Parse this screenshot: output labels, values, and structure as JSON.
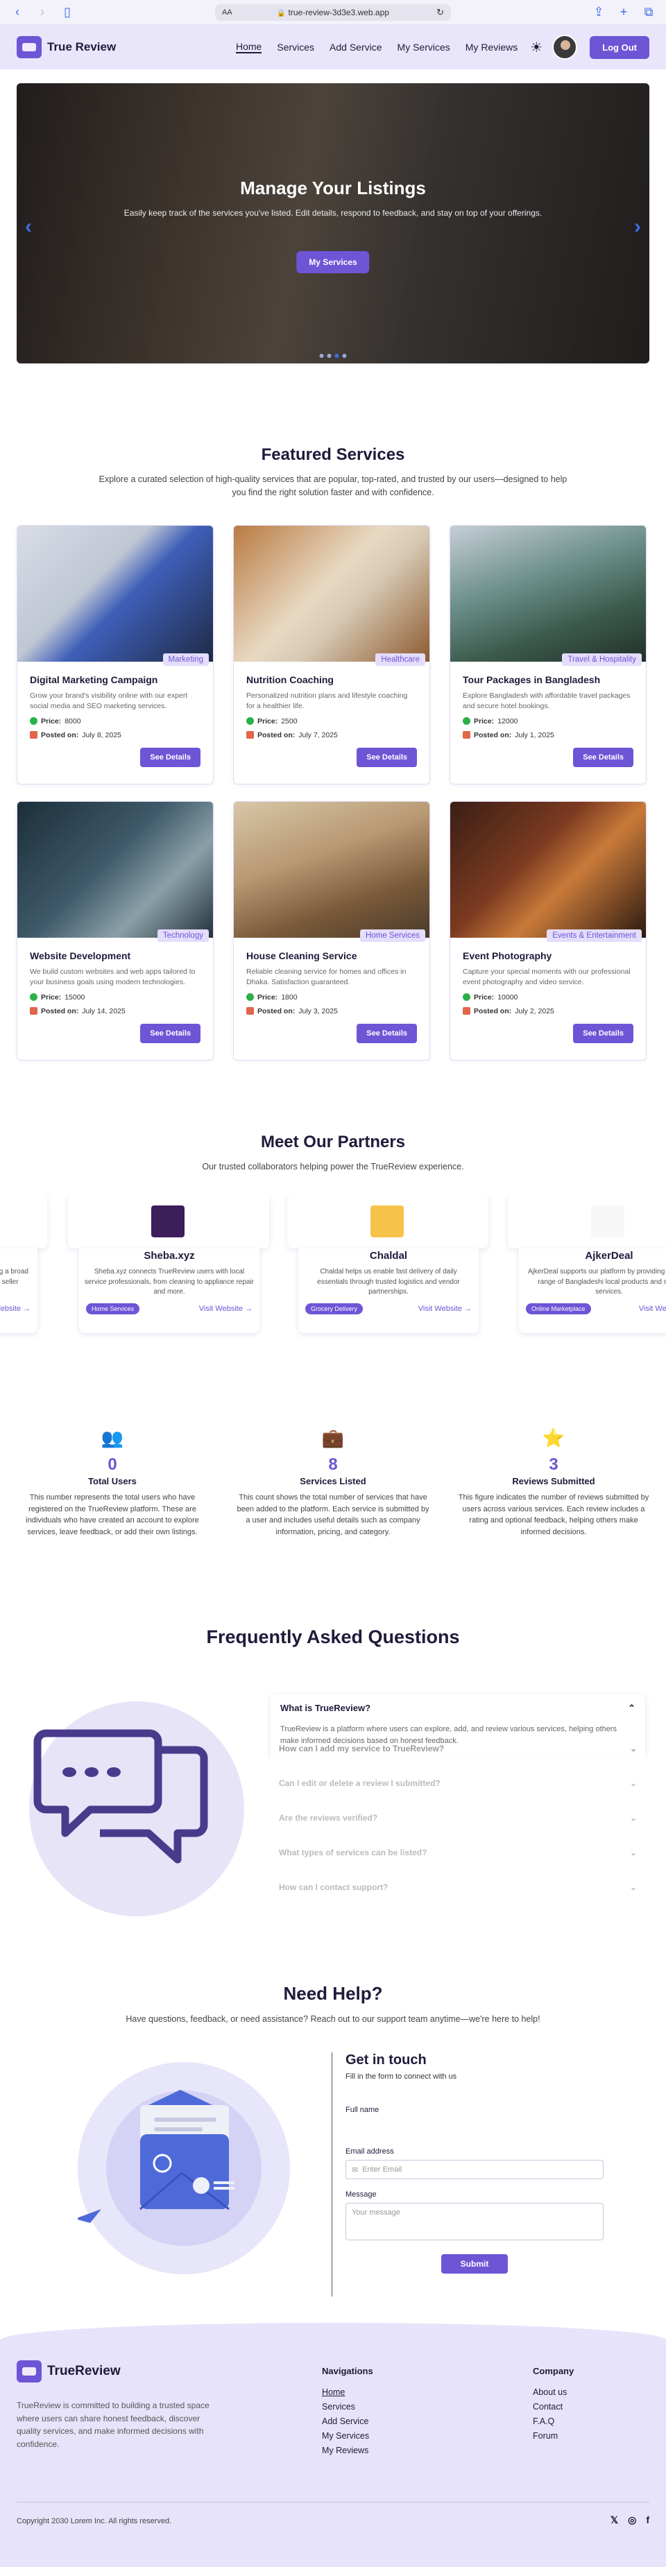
{
  "browser": {
    "aa": "AA",
    "url": "true-review-3d3e3.web.app"
  },
  "nav": {
    "brand": "True Review",
    "links": [
      "Home",
      "Services",
      "Add Service",
      "My Services",
      "My Reviews"
    ],
    "logout": "Log Out"
  },
  "hero": {
    "title": "Manage Your Listings",
    "subtitle": "Easily keep track of the services you've listed. Edit details, respond to feedback, and stay on top of your offerings.",
    "button": "My Services"
  },
  "featured": {
    "title": "Featured Services",
    "subtitle": "Explore a curated selection of high-quality services that are popular, top-rated, and trusted by our users—designed to help you find the right solution faster and with confidence.",
    "price_label": "Price:",
    "posted_label": "Posted on:",
    "button": "See Details",
    "cards": [
      {
        "tag": "Marketing",
        "title": "Digital Marketing Campaign",
        "desc": "Grow your brand's visibility online with our expert social media and SEO marketing services.",
        "price": "8000",
        "date": "July 8, 2025"
      },
      {
        "tag": "Healthcare",
        "title": "Nutrition Coaching",
        "desc": "Personalized nutrition plans and lifestyle coaching for a healthier life.",
        "price": "2500",
        "date": "July 7, 2025"
      },
      {
        "tag": "Travel & Hospitality",
        "title": "Tour Packages in Bangladesh",
        "desc": "Explore Bangladesh with affordable travel packages and secure hotel bookings.",
        "price": "12000",
        "date": "July 1, 2025"
      },
      {
        "tag": "Technology",
        "title": "Website Development",
        "desc": "We build custom websites and web apps tailored to your business goals using modern technologies.",
        "price": "15000",
        "date": "July 14, 2025"
      },
      {
        "tag": "Home Services",
        "title": "House Cleaning Service",
        "desc": "Reliable cleaning service for homes and offices in Dhaka. Satisfaction guaranteed.",
        "price": "1800",
        "date": "July 3, 2025"
      },
      {
        "tag": "Events & Entertainment",
        "title": "Event Photography",
        "desc": "Capture your special moments with our professional event photography and video service.",
        "price": "10000",
        "date": "July 2, 2025"
      }
    ]
  },
  "partners": {
    "title": "Meet Our Partners",
    "subtitle": "Our trusted collaborators helping power the TrueReview experience.",
    "link": "Visit Website →",
    "items": [
      {
        "name": "Sheba.xyz",
        "desc": "Sheba.xyz connects TrueReview users with local service professionals, from cleaning to appliance repair and more.",
        "category": "Home Services"
      },
      {
        "name": "Chaldal",
        "desc": "Chaldal helps us enable fast delivery of daily essentials through trusted logistics and vendor partnerships.",
        "category": "Grocery Delivery"
      },
      {
        "name": "AjkerDeal",
        "desc": "AjkerDeal supports our platform by providing a broad range of Bangladeshi local products and seller services.",
        "category": "Online Marketplace"
      }
    ]
  },
  "stats": [
    {
      "icon": "users-icon",
      "value": "0",
      "label": "Total Users",
      "desc": "This number represents the total users who have registered on the TrueReview platform. These are individuals who have created an account to explore services, leave feedback, or add their own listings."
    },
    {
      "icon": "briefcase-icon",
      "value": "8",
      "label": "Services Listed",
      "desc": "This count shows the total number of services that have been added to the platform. Each service is submitted by a user and includes useful details such as company information, pricing, and category."
    },
    {
      "icon": "star-icon",
      "value": "3",
      "label": "Reviews Submitted",
      "desc": "This figure indicates the number of reviews submitted by users across various services. Each review includes a rating and optional feedback, helping others make informed decisions."
    }
  ],
  "faq": {
    "title": "Frequently Asked Questions",
    "open_q": "What is TrueReview?",
    "open_a": "TrueReview is a platform where users can explore, add, and review various services, helping others make informed decisions based on honest feedback.",
    "items": [
      "How can I add my service to TrueReview?",
      "Can I edit or delete a review I submitted?",
      "Are the reviews verified?",
      "What types of services can be listed?",
      "How can I contact support?"
    ]
  },
  "help": {
    "title": "Need Help?",
    "subtitle": "Have questions, feedback, or need assistance? Reach out to our support team anytime—we're here to help!",
    "form_title": "Get in touch",
    "form_sub": "Fill in the form to connect with us",
    "name_label": "Full name",
    "email_label": "Email address",
    "email_placeholder": "Enter Email",
    "message_label": "Message",
    "message_placeholder": "Your message",
    "submit": "Submit"
  },
  "footer": {
    "brand": "TrueReview",
    "about": "TrueReview is committed to building a trusted space where users can share honest feedback, discover quality services, and make informed decisions with confidence.",
    "nav_title": "Navigations",
    "nav_links": [
      "Home",
      "Services",
      "Add Service",
      "My Services",
      "My Reviews"
    ],
    "company_title": "Company",
    "company_links": [
      "About us",
      "Contact",
      "F.A.Q",
      "Forum"
    ],
    "copyright": "Copyright 2030 Lorem Inc. All rights reserved.",
    "social": [
      "x-icon",
      "instagram-icon",
      "facebook-icon"
    ]
  },
  "colors": {
    "primary": "#6d55d6",
    "nav_bg": "#e9e6fb",
    "accent_blue": "#3b6ee8"
  }
}
